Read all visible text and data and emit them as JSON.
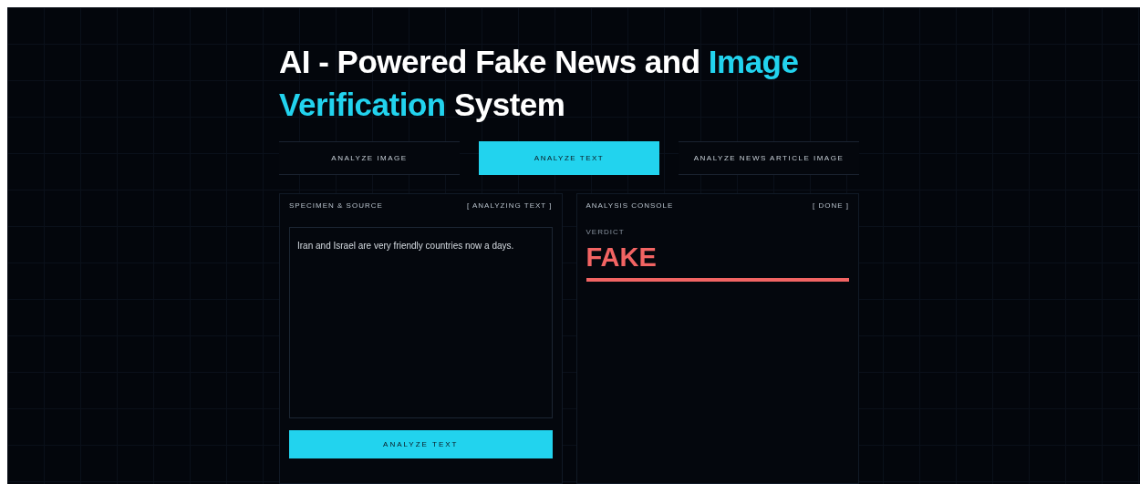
{
  "title": "AI - Powered Fake News and **Image Verification** System",
  "tabs": [
    {
      "label": "ANALYZE IMAGE",
      "selected": false
    },
    {
      "label": "ANALYZE TEXT",
      "selected": true
    },
    {
      "label": "ANALYZE NEWS ARTICLE IMAGE",
      "selected": false
    }
  ],
  "input_panel": {
    "heading": "SPECIMEN & SOURCE",
    "status": "[ ANALYZING TEXT ]",
    "text_value": "Iran and Israel are very friendly countries now a days.",
    "button": "ANALYZE TEXT"
  },
  "result_panel": {
    "heading": "ANALYSIS CONSOLE",
    "status": "[ DONE ]",
    "verdict_label": "VERDICT",
    "verdict": "FAKE",
    "level": 1
  }
}
